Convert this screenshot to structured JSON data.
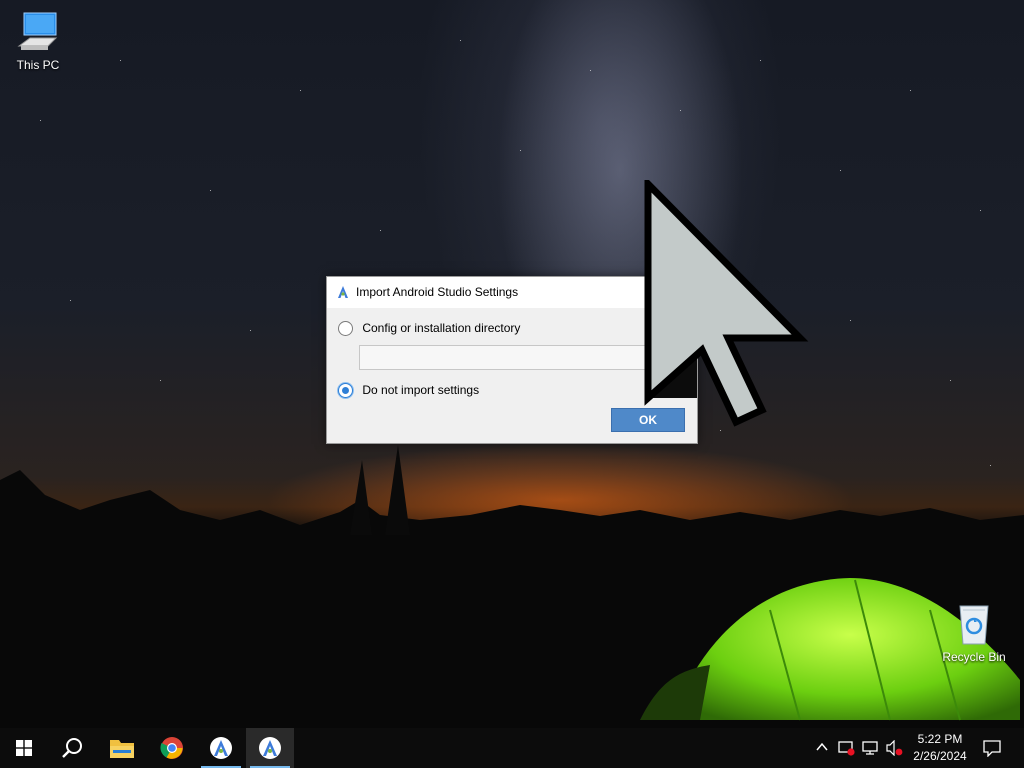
{
  "desktop": {
    "icons": [
      {
        "label": "This PC",
        "icon": "computer-icon"
      },
      {
        "label": "Recycle Bin",
        "icon": "recycle-bin-icon"
      }
    ]
  },
  "dialog": {
    "title": "Import Android Studio Settings",
    "icon": "android-studio-icon",
    "close_label": "✕",
    "options": [
      {
        "label": "Config or installation directory",
        "selected": false
      },
      {
        "label": "Do not import settings",
        "selected": true
      }
    ],
    "directory_value": "",
    "ok_label": "OK"
  },
  "taskbar": {
    "items": [
      {
        "name": "start",
        "icon": "windows-logo-icon"
      },
      {
        "name": "search",
        "icon": "search-icon"
      },
      {
        "name": "file-explorer",
        "icon": "folder-icon"
      },
      {
        "name": "chrome",
        "icon": "chrome-icon"
      },
      {
        "name": "android-studio",
        "icon": "android-studio-icon",
        "running": true
      },
      {
        "name": "android-studio-2",
        "icon": "android-studio-icon",
        "running": true,
        "active": true
      }
    ],
    "tray": {
      "time": "5:22 PM",
      "date": "2/26/2024",
      "icons": [
        "chevron-up-icon",
        "security-alert-icon",
        "network-icon",
        "volume-muted-icon",
        "notification-icon"
      ]
    }
  },
  "colors": {
    "accent": "#4f89c9",
    "taskbar_running": "#76b9ed"
  }
}
